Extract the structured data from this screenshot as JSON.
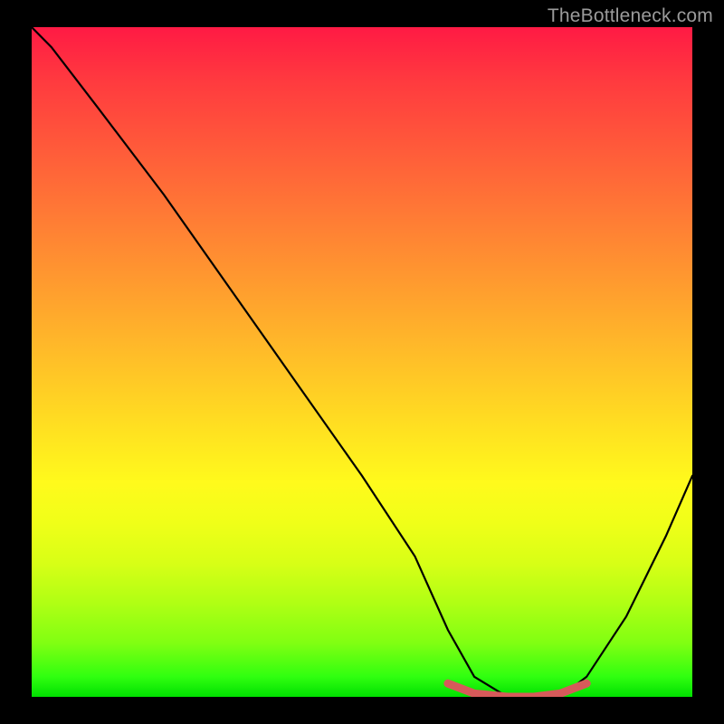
{
  "watermark": "TheBottleneck.com",
  "chart_data": {
    "type": "line",
    "title": "",
    "xlabel": "",
    "ylabel": "",
    "xlim": [
      0,
      100
    ],
    "ylim": [
      0,
      100
    ],
    "series": [
      {
        "name": "bottleneck-curve",
        "color": "#000000",
        "x": [
          0,
          3,
          10,
          20,
          30,
          40,
          50,
          58,
          63,
          67,
          72,
          76,
          80,
          84,
          90,
          96,
          100
        ],
        "y": [
          100,
          97,
          88,
          75,
          61,
          47,
          33,
          21,
          10,
          3,
          0,
          0,
          0,
          3,
          12,
          24,
          33
        ]
      },
      {
        "name": "optimum-marker",
        "color": "#d65a5a",
        "x": [
          63,
          67,
          72,
          76,
          80,
          84
        ],
        "y": [
          2.0,
          0.5,
          0,
          0,
          0.5,
          2.0
        ]
      }
    ],
    "background_gradient": {
      "top": "#ff1a44",
      "bottom": "#00e000"
    }
  }
}
